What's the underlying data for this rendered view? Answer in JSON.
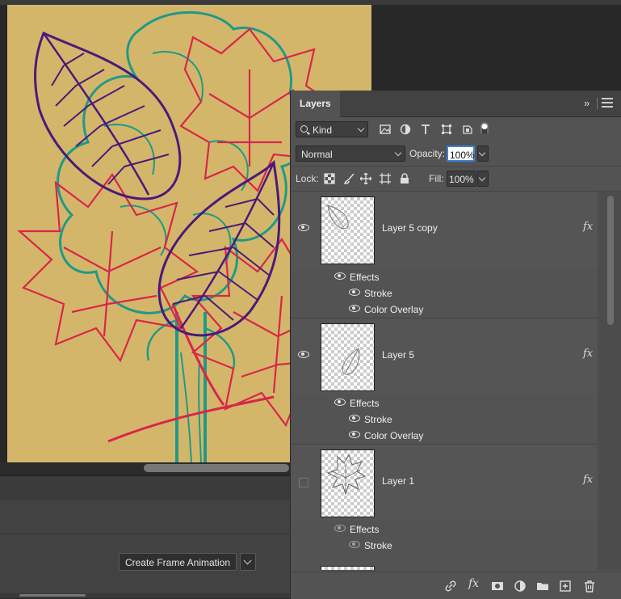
{
  "timeline": {
    "create_frame_label": "Create Frame Animation"
  },
  "layers_panel": {
    "tab_label": "Layers",
    "filter": {
      "kind_label": "Kind"
    },
    "blend_mode": "Normal",
    "opacity_label": "Opacity:",
    "opacity_value": "100%",
    "lock_label": "Lock:",
    "fill_label": "Fill:",
    "fill_value": "100%",
    "layers": [
      {
        "name": "Layer 5 copy",
        "visible": true,
        "effects_label": "Effects",
        "effects": [
          "Stroke",
          "Color Overlay"
        ],
        "fx": "fx"
      },
      {
        "name": "Layer 5",
        "visible": true,
        "effects_label": "Effects",
        "effects": [
          "Stroke",
          "Color Overlay"
        ],
        "fx": "fx"
      },
      {
        "name": "Layer 1",
        "visible": false,
        "effects_label": "Effects",
        "effects": [
          "Stroke"
        ],
        "fx": "fx"
      }
    ],
    "footer_fx": "fx"
  },
  "colors": {
    "canvas_bg": "#d4b66a",
    "leaf_purple": "#4a1a7a",
    "tree_teal": "#1f9a86",
    "maple_red": "#d8264a",
    "panel_bg": "#535353",
    "accent_focus": "#3f80d6"
  }
}
